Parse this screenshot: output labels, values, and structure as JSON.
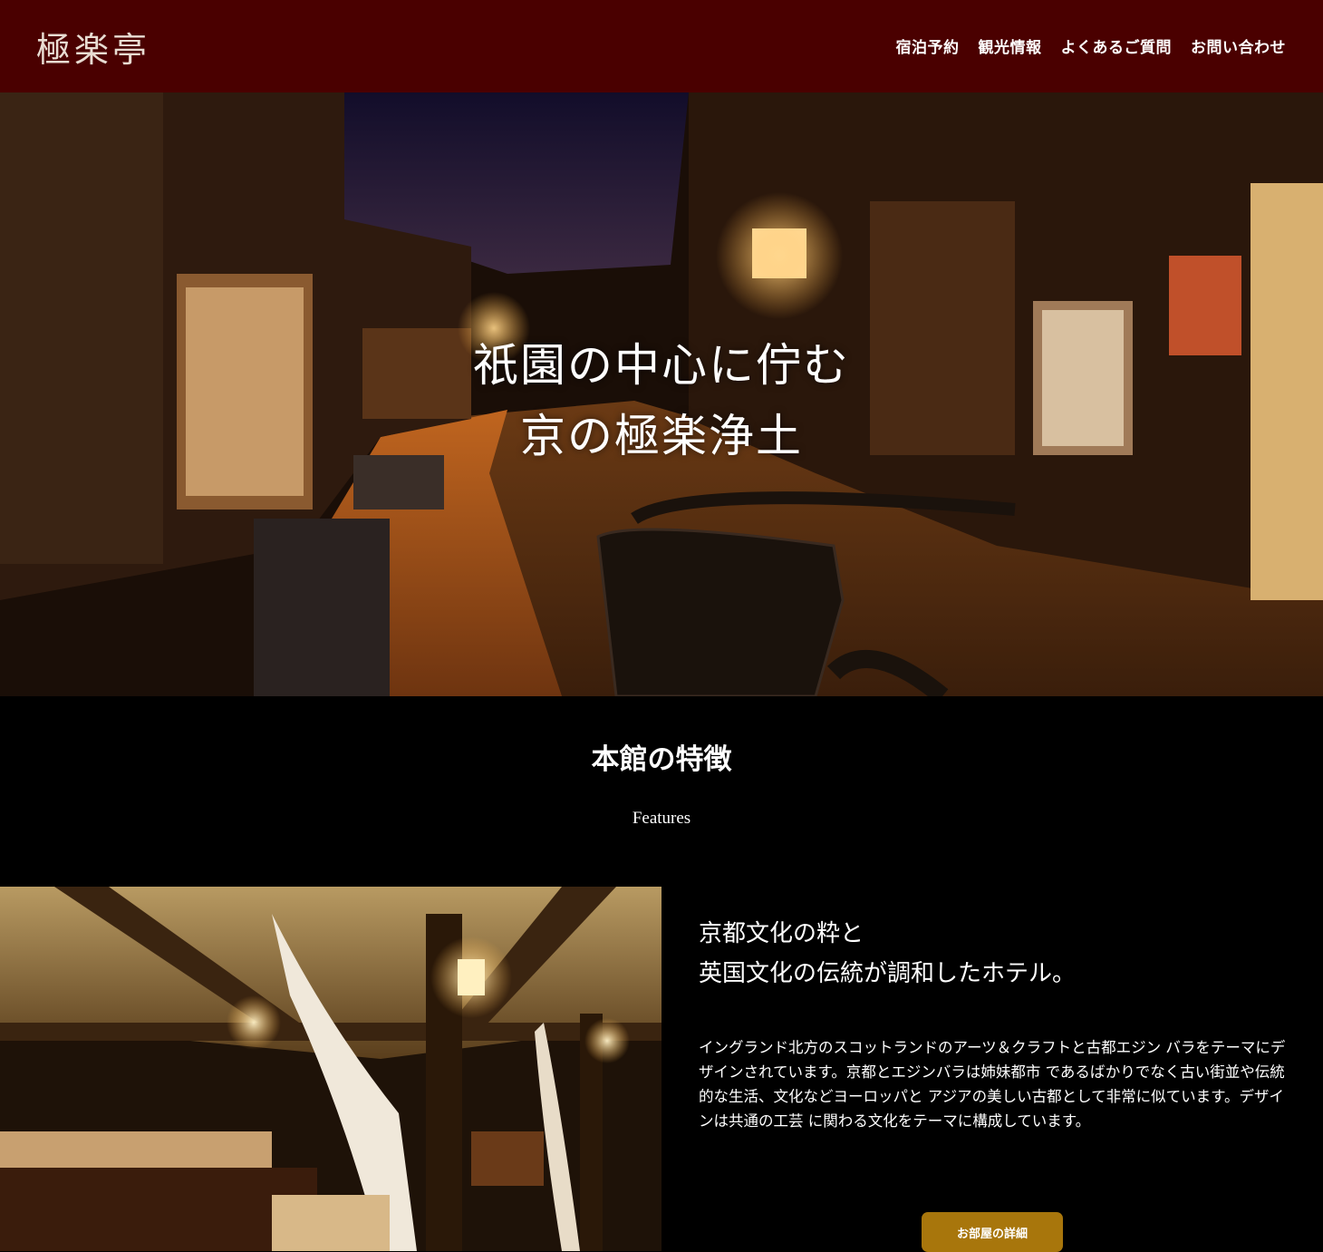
{
  "header": {
    "logo": "極楽亭",
    "nav": [
      "宿泊予約",
      "観光情報",
      "よくあるご質問",
      "お問い合わせ"
    ]
  },
  "hero": {
    "title_line1": "祇園の中心に佇む",
    "title_line2": "京の極楽浄土"
  },
  "features": {
    "title": "本館の特徴",
    "subtitle": "Features",
    "heading_line1": "京都文化の粋と",
    "heading_line2": "英国文化の伝統が調和したホテル。",
    "body": "イングランド北方のスコットランドのアーツ＆クラフトと古都エジン バラをテーマにデザインされています。京都とエジンバラは姉妹都市 であるばかりでなく古い街並や伝統的な生活、文化などヨーロッパと アジアの美しい古都として非常に似ています。デザインは共通の工芸 に関わる文化をテーマに構成しています。",
    "button_label": "お部屋の詳細"
  },
  "colors": {
    "header_bg": "#4a0000",
    "button_bg": "#a8760c",
    "page_bg": "#000000"
  }
}
